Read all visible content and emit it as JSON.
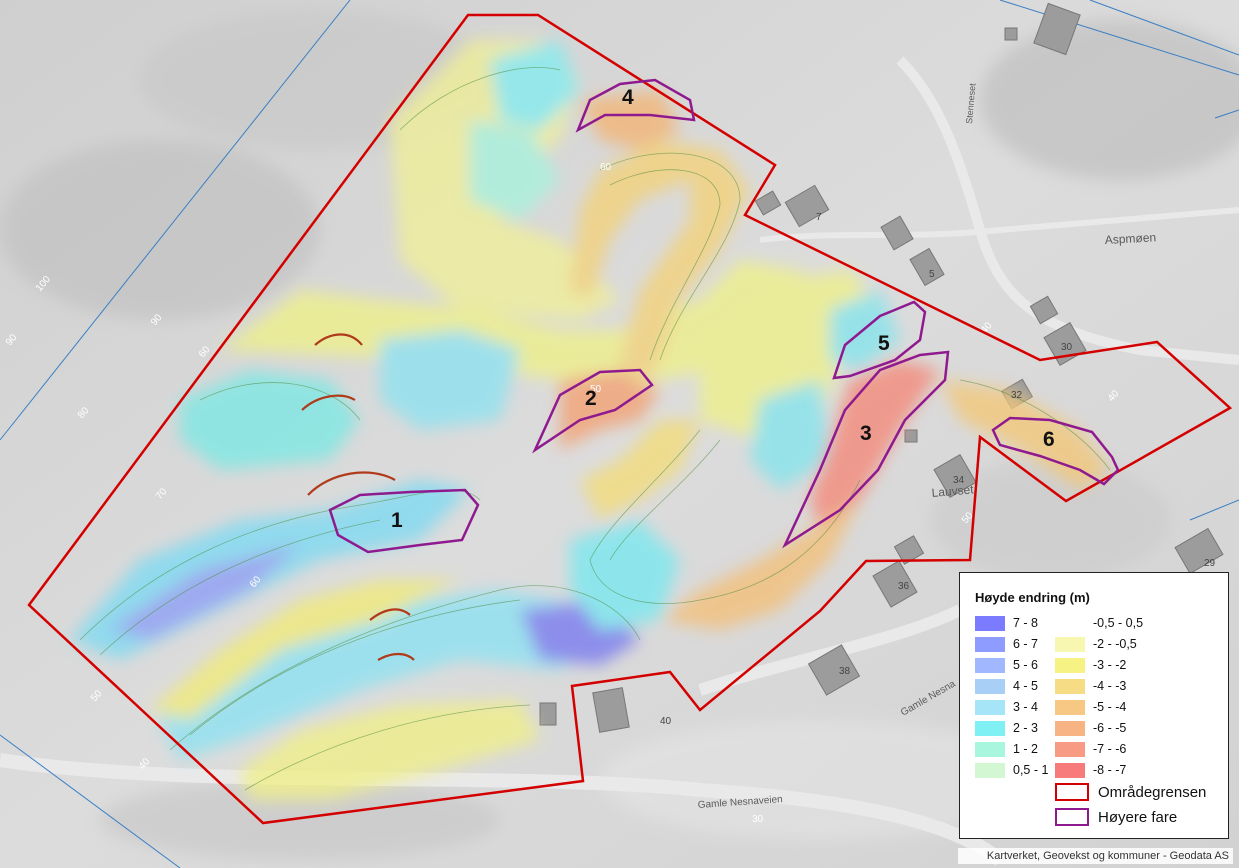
{
  "map": {
    "place_names": {
      "aspmoen": "Aspmøen",
      "lauvset": "Lauvset",
      "stenneset": "Stenneset"
    },
    "roads": {
      "gamle_nesnaveien": "Gamle Nesnaveien",
      "gamle_nesna_short": "Gamle Nesna"
    },
    "house_numbers": [
      "7",
      "5",
      "30",
      "32",
      "34",
      "29",
      "36",
      "38",
      "40"
    ],
    "contour_labels": [
      "100",
      "90",
      "90",
      "80",
      "70",
      "60",
      "50",
      "40",
      "40",
      "40",
      "50",
      "60",
      "30",
      "50",
      "60"
    ],
    "zones": [
      "1",
      "2",
      "3",
      "4",
      "5",
      "6"
    ],
    "colors": {
      "boundary": "#d40000",
      "hazard": "#8f1a8f"
    }
  },
  "legend": {
    "title": "Høyde endring (m)",
    "left_items": [
      {
        "label": "7 - 8",
        "color": "#7b7bff"
      },
      {
        "label": "6 - 7",
        "color": "#8e9bff"
      },
      {
        "label": "5 - 6",
        "color": "#a1b7ff"
      },
      {
        "label": "4 - 5",
        "color": "#a8d0f7"
      },
      {
        "label": "3 - 4",
        "color": "#a6e4f7"
      },
      {
        "label": "2 - 3",
        "color": "#7ff0f4"
      },
      {
        "label": "1 - 2",
        "color": "#a8f6de"
      },
      {
        "label": "0,5 - 1",
        "color": "#d3f7d3"
      }
    ],
    "right_items": [
      {
        "label": "-0,5 - 0,5",
        "color": "#ffffff"
      },
      {
        "label": "-2 - -0,5",
        "color": "#f7f7b2"
      },
      {
        "label": "-3 - -2",
        "color": "#f7f284"
      },
      {
        "label": "-4 - -3",
        "color": "#f7dc86"
      },
      {
        "label": "-5 - -4",
        "color": "#f7c784"
      },
      {
        "label": "-6 - -5",
        "color": "#f7b384"
      },
      {
        "label": "-7 - -6",
        "color": "#f79b84"
      },
      {
        "label": "-8 - -7",
        "color": "#f77b7b"
      }
    ],
    "boundary_label": "Områdegrensen",
    "hazard_label": "Høyere fare"
  },
  "attribution": "Kartverket, Geovekst og kommuner - Geodata AS"
}
